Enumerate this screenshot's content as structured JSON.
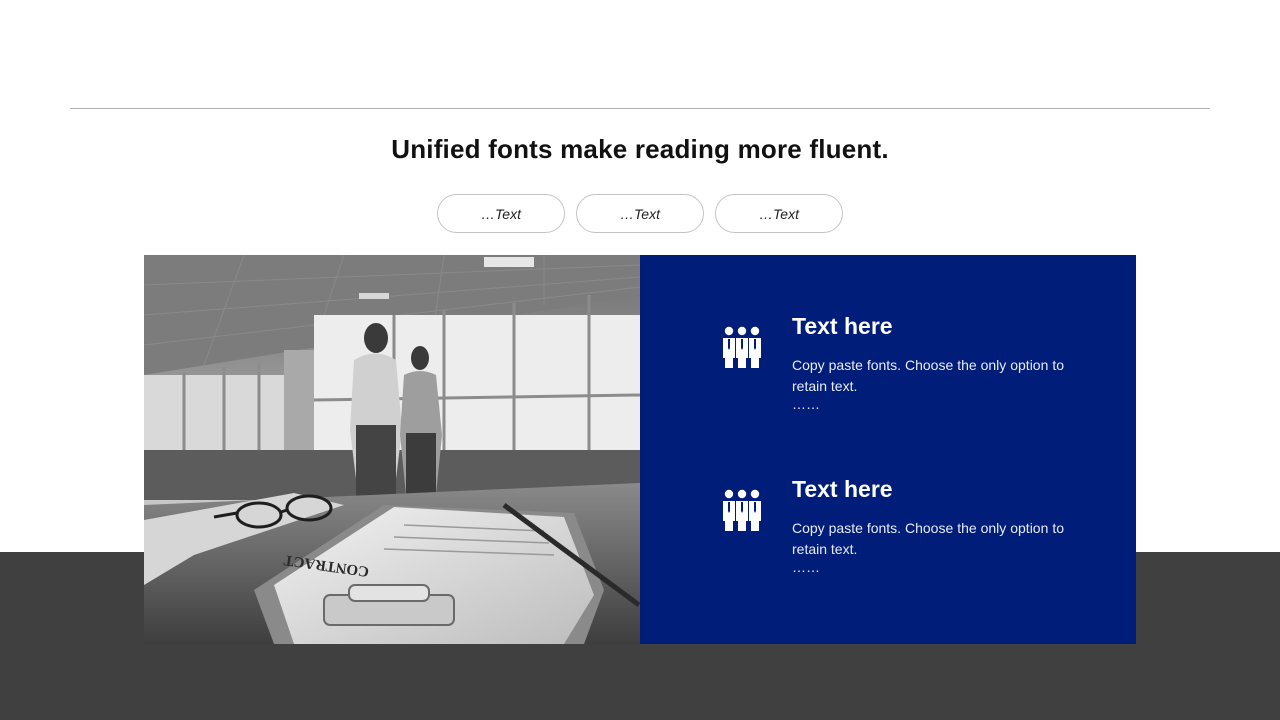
{
  "headline": "Unified fonts make reading more fluent.",
  "pills": [
    "…Text",
    "…Text",
    "…Text"
  ],
  "photo": {
    "document_label": "CONTRACT"
  },
  "features": [
    {
      "icon": "team-icon",
      "title": "Text here",
      "description": "Copy paste fonts. Choose the only option to retain text.",
      "ellipsis": "……"
    },
    {
      "icon": "team-icon",
      "title": "Text here",
      "description": "Copy paste fonts. Choose the only option to retain text.",
      "ellipsis": "……"
    }
  ],
  "colors": {
    "accent_blue": "#001d7a",
    "footer_gray": "#404040",
    "rule_gray": "#b3b3b3"
  }
}
